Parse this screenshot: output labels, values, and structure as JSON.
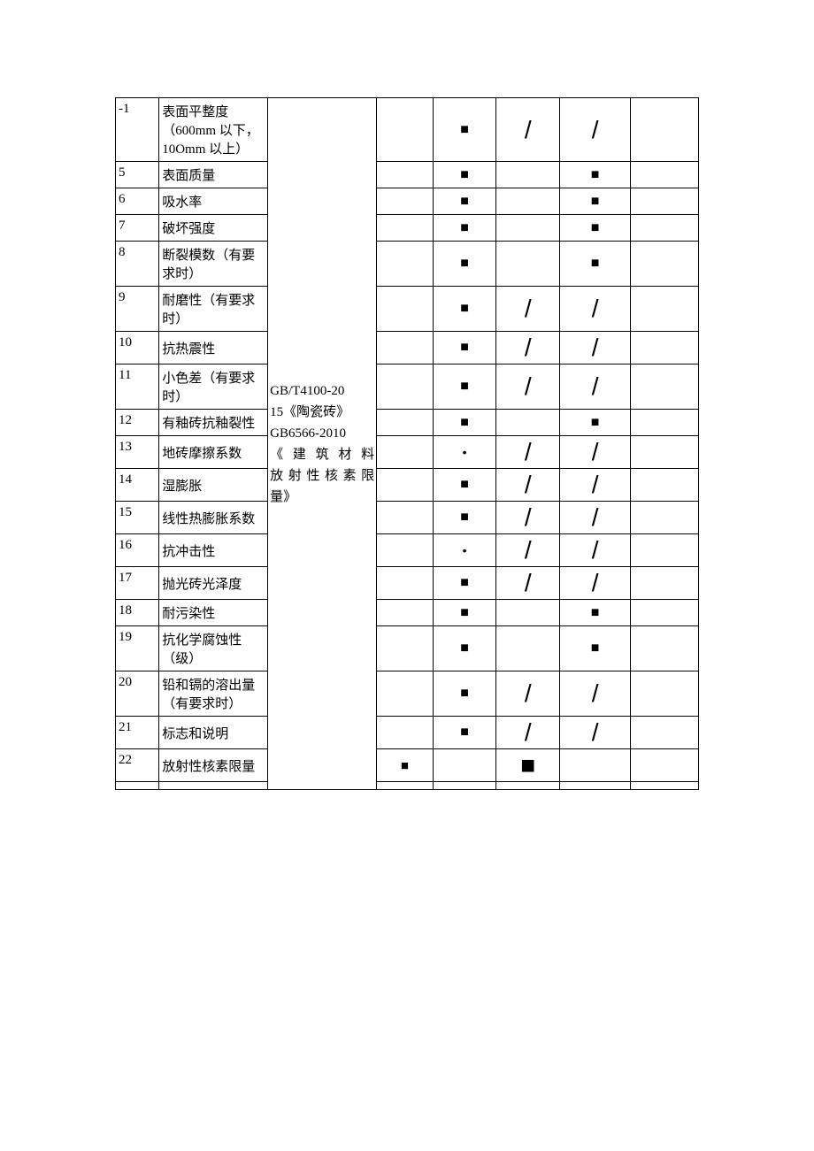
{
  "standard_text": "GB/T4100-2015《陶瓷砖》GB6566-2010《建筑材料放射性核素限量》",
  "rows": [
    {
      "idx": "-1",
      "desc": "表面平整度（600mm 以下，10Omm 以上）",
      "c3": "",
      "c4": "■",
      "c5": "/",
      "c6": "/",
      "c7": ""
    },
    {
      "idx": "5",
      "desc": "表面质量",
      "c3": "",
      "c4": "■",
      "c5": "",
      "c6": "■",
      "c7": ""
    },
    {
      "idx": "6",
      "desc": "吸水率",
      "c3": "",
      "c4": "■",
      "c5": "",
      "c6": "■",
      "c7": ""
    },
    {
      "idx": "7",
      "desc": "破坏强度",
      "c3": "",
      "c4": "■",
      "c5": "",
      "c6": "■",
      "c7": ""
    },
    {
      "idx": "8",
      "desc": "断裂模数（有要求时）",
      "c3": "",
      "c4": "■",
      "c5": "",
      "c6": "■",
      "c7": ""
    },
    {
      "idx": "9",
      "desc": "耐磨性（有要求时）",
      "c3": "",
      "c4": "■",
      "c5": "/",
      "c6": "/",
      "c7": ""
    },
    {
      "idx": "10",
      "desc": "抗热震性",
      "c3": "",
      "c4": "■",
      "c5": "/",
      "c6": "/",
      "c7": ""
    },
    {
      "idx": "11",
      "desc": "小色差（有要求时）",
      "c3": "",
      "c4": "■",
      "c5": "/",
      "c6": "/",
      "c7": ""
    },
    {
      "idx": "12",
      "desc": "有釉砖抗釉裂性",
      "c3": "",
      "c4": "■",
      "c5": "",
      "c6": "■",
      "c7": ""
    },
    {
      "idx": "13",
      "desc": "地砖摩擦系数",
      "c3": "",
      "c4": "•",
      "c5": "/",
      "c6": "/",
      "c7": ""
    },
    {
      "idx": "14",
      "desc": "湿膨胀",
      "c3": "",
      "c4": "■",
      "c5": "/",
      "c6": "/",
      "c7": ""
    },
    {
      "idx": "15",
      "desc": "线性热膨胀系数",
      "c3": "",
      "c4": "■",
      "c5": "/",
      "c6": "/",
      "c7": ""
    },
    {
      "idx": "16",
      "desc": "抗冲击性",
      "c3": "",
      "c4": "•",
      "c5": "/",
      "c6": "/",
      "c7": ""
    },
    {
      "idx": "17",
      "desc": "抛光砖光泽度",
      "c3": "",
      "c4": "■",
      "c5": "/",
      "c6": "/",
      "c7": ""
    },
    {
      "idx": "18",
      "desc": "耐污染性",
      "c3": "",
      "c4": "■",
      "c5": "",
      "c6": "■",
      "c7": ""
    },
    {
      "idx": "19",
      "desc": "抗化学腐蚀性（级）",
      "c3": "",
      "c4": "■",
      "c5": "",
      "c6": "■",
      "c7": ""
    },
    {
      "idx": "20",
      "desc": "铅和镉的溶出量（有要求时）",
      "c3": "",
      "c4": "■",
      "c5": "/",
      "c6": "/",
      "c7": ""
    },
    {
      "idx": "21",
      "desc": "标志和说明",
      "c3": "",
      "c4": "■",
      "c5": "/",
      "c6": "/",
      "c7": ""
    },
    {
      "idx": "22",
      "desc": "放射性核素限量",
      "c3": "■",
      "c4": "",
      "c5": "■",
      "c6": "",
      "c7": ""
    }
  ]
}
